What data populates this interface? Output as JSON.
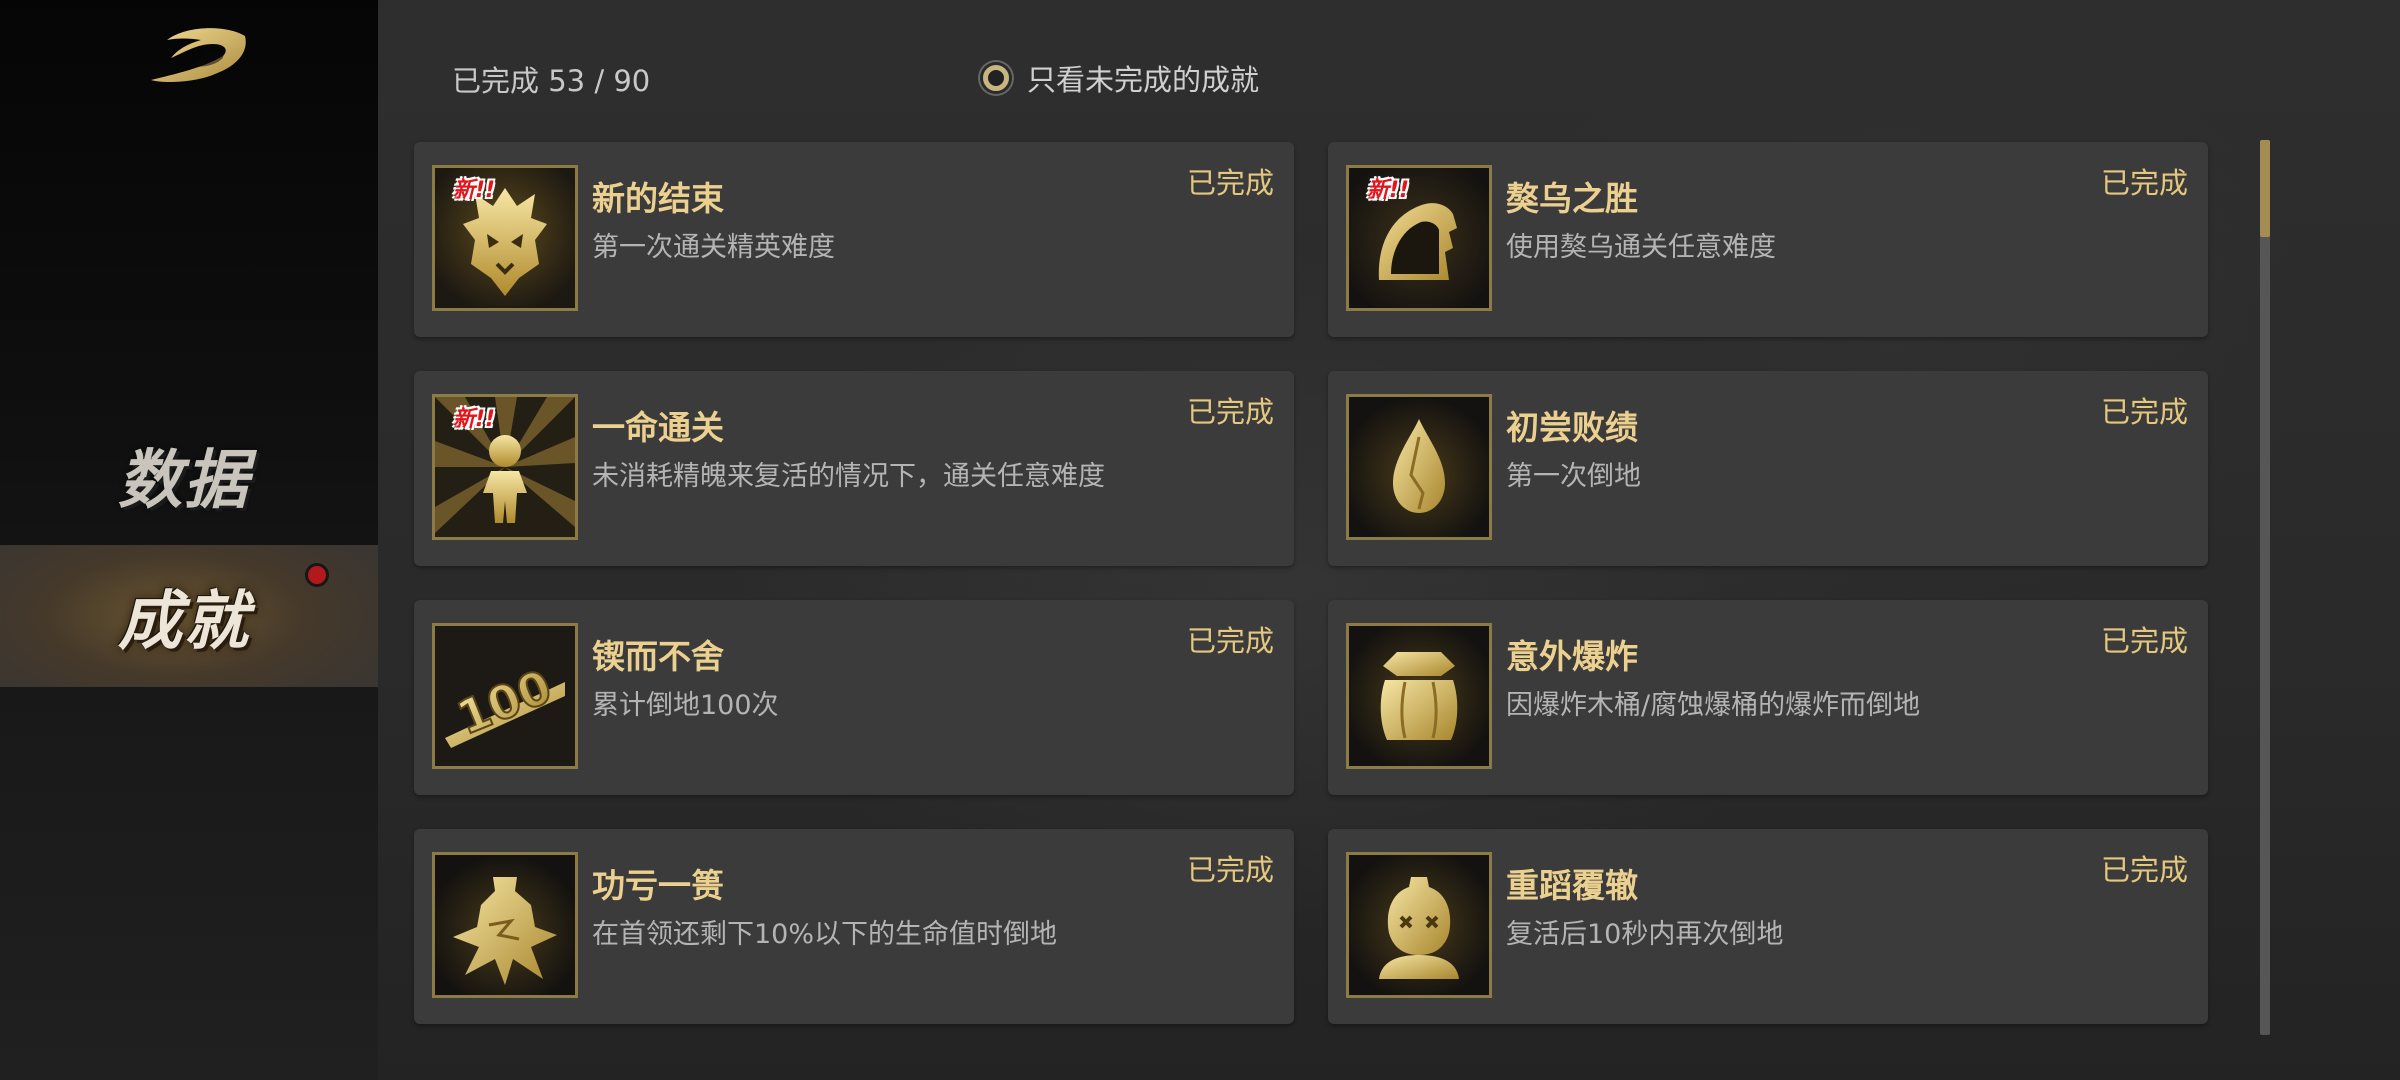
{
  "sidebar": {
    "logo_icon": "brush-swoosh-logo",
    "nav": [
      {
        "label": "数据",
        "active": false
      },
      {
        "label": "成就",
        "active": true,
        "notification": true
      }
    ]
  },
  "header": {
    "progress_prefix": "已完成",
    "progress_text": "53 / 90",
    "completed": 53,
    "total": 90,
    "filter_label": "只看未完成的成就",
    "filter_checked": false
  },
  "achievements": [
    {
      "title": "新的结束",
      "desc": "第一次通关精英难度",
      "status": "已完成",
      "new_tag": "新!!",
      "is_new": true,
      "icon": "demon-mask-icon"
    },
    {
      "title": "獒乌之胜",
      "desc": "使用獒乌通关任意难度",
      "status": "已完成",
      "new_tag": "新!!",
      "is_new": true,
      "icon": "hooded-head-icon"
    },
    {
      "title": "一命通关",
      "desc": "未消耗精魄来复活的情况下，通关任意难度",
      "status": "已完成",
      "new_tag": "新!!",
      "is_new": true,
      "icon": "figure-sunburst-icon"
    },
    {
      "title": "初尝败绩",
      "desc": "第一次倒地",
      "status": "已完成",
      "is_new": false,
      "icon": "drop-crystal-icon"
    },
    {
      "title": "锲而不舍",
      "desc": "累计倒地100次",
      "status": "已完成",
      "is_new": false,
      "icon": "hundred-icon"
    },
    {
      "title": "意外爆炸",
      "desc": "因爆炸木桶/腐蚀爆桶的爆炸而倒地",
      "status": "已完成",
      "is_new": false,
      "icon": "barrel-icon"
    },
    {
      "title": "功亏一篑",
      "desc": "在首领还剩下10%以下的生命值时倒地",
      "status": "已完成",
      "is_new": false,
      "icon": "broken-vase-icon"
    },
    {
      "title": "重蹈覆辙",
      "desc": "复活后10秒内再次倒地",
      "status": "已完成",
      "is_new": false,
      "icon": "knocked-out-head-icon"
    }
  ],
  "colors": {
    "gold": "#e4c87f",
    "title_gold": "#ecd08f",
    "badge_border": "#8c7b45",
    "new_red": "#e3141a",
    "notify_red": "#b3191a"
  },
  "scrollbar": {
    "position": 0.0,
    "visible_fraction": 0.11
  }
}
